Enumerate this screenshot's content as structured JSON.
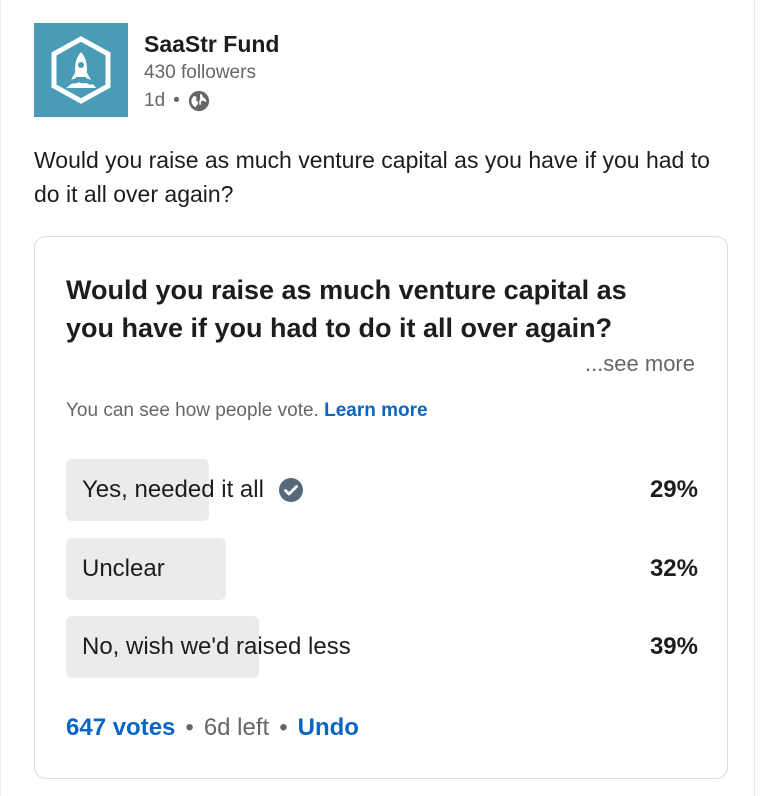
{
  "author": {
    "name": "SaaStr Fund",
    "followers": "430 followers",
    "time": "1d",
    "separator": "•",
    "avatar_color": "#4a9bb5",
    "visibility_icon": "globe-icon"
  },
  "post": {
    "text": "Would you raise as much venture capital as you have if you had to do it all over again?"
  },
  "poll": {
    "question": "Would you raise as much venture capital as you have if you had to do it all over again?",
    "see_more": "...see more",
    "visibility_text": "You can see how people vote.",
    "learn_more": "Learn more",
    "options": [
      {
        "label": "Yes, needed it all",
        "percent_label": "29%",
        "percent": 29,
        "selected": true
      },
      {
        "label": "Unclear",
        "percent_label": "32%",
        "percent": 32,
        "selected": false
      },
      {
        "label": "No, wish we'd raised less",
        "percent_label": "39%",
        "percent": 39,
        "selected": false
      }
    ],
    "votes": "647 votes",
    "time_left": "6d left",
    "undo": "Undo",
    "separator": "•"
  },
  "colors": {
    "link": "#0a66c2",
    "bar": "#ebebeb",
    "check": "#56687a"
  }
}
